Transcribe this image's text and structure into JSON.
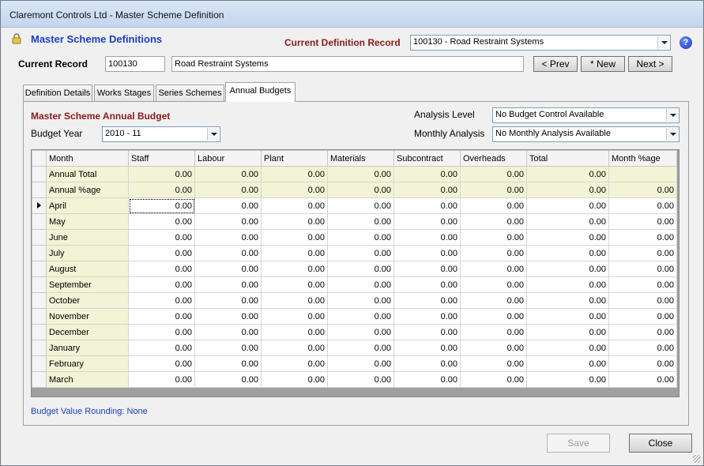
{
  "window": {
    "title": "Claremont Controls Ltd - Master Scheme Definition"
  },
  "header": {
    "title": "Master Scheme Definitions",
    "current_definition_label": "Current Definition Record",
    "current_definition_value": "100130 - Road Restraint Systems",
    "help_glyph": "?",
    "lock_icon": "padlock-icon"
  },
  "record": {
    "label": "Current Record",
    "code": "100130",
    "name": "Road Restraint Systems",
    "prev_label": "< Prev",
    "new_label": "* New",
    "next_label": "Next >"
  },
  "tabs": [
    "Definition Details",
    "Works Stages",
    "Series Schemes",
    "Annual Budgets"
  ],
  "budget": {
    "section_title": "Master Scheme Annual Budget",
    "year_label": "Budget Year",
    "year_value": "2010 - 11",
    "analysis_level_label": "Analysis Level",
    "analysis_level_value": "No Budget Control Available",
    "monthly_analysis_label": "Monthly Analysis",
    "monthly_analysis_value": "No Monthly Analysis Available",
    "rounding_text": "Budget Value Rounding: None"
  },
  "grid": {
    "columns": [
      "Month",
      "Staff",
      "Labour",
      "Plant",
      "Materials",
      "Subcontract",
      "Overheads",
      "Total",
      "Month %age"
    ],
    "summary_rows": [
      {
        "label": "Annual Total",
        "values": [
          "0.00",
          "0.00",
          "0.00",
          "0.00",
          "0.00",
          "0.00",
          "0.00",
          ""
        ]
      },
      {
        "label": "Annual %age",
        "values": [
          "0.00",
          "0.00",
          "0.00",
          "0.00",
          "0.00",
          "0.00",
          "0.00",
          "0.00"
        ]
      }
    ],
    "month_rows": [
      {
        "label": "April",
        "values": [
          "0.00",
          "0.00",
          "0.00",
          "0.00",
          "0.00",
          "0.00",
          "0.00",
          "0.00"
        ]
      },
      {
        "label": "May",
        "values": [
          "0.00",
          "0.00",
          "0.00",
          "0.00",
          "0.00",
          "0.00",
          "0.00",
          "0.00"
        ]
      },
      {
        "label": "June",
        "values": [
          "0.00",
          "0.00",
          "0.00",
          "0.00",
          "0.00",
          "0.00",
          "0.00",
          "0.00"
        ]
      },
      {
        "label": "July",
        "values": [
          "0.00",
          "0.00",
          "0.00",
          "0.00",
          "0.00",
          "0.00",
          "0.00",
          "0.00"
        ]
      },
      {
        "label": "August",
        "values": [
          "0.00",
          "0.00",
          "0.00",
          "0.00",
          "0.00",
          "0.00",
          "0.00",
          "0.00"
        ]
      },
      {
        "label": "September",
        "values": [
          "0.00",
          "0.00",
          "0.00",
          "0.00",
          "0.00",
          "0.00",
          "0.00",
          "0.00"
        ]
      },
      {
        "label": "October",
        "values": [
          "0.00",
          "0.00",
          "0.00",
          "0.00",
          "0.00",
          "0.00",
          "0.00",
          "0.00"
        ]
      },
      {
        "label": "November",
        "values": [
          "0.00",
          "0.00",
          "0.00",
          "0.00",
          "0.00",
          "0.00",
          "0.00",
          "0.00"
        ]
      },
      {
        "label": "December",
        "values": [
          "0.00",
          "0.00",
          "0.00",
          "0.00",
          "0.00",
          "0.00",
          "0.00",
          "0.00"
        ]
      },
      {
        "label": "January",
        "values": [
          "0.00",
          "0.00",
          "0.00",
          "0.00",
          "0.00",
          "0.00",
          "0.00",
          "0.00"
        ]
      },
      {
        "label": "February",
        "values": [
          "0.00",
          "0.00",
          "0.00",
          "0.00",
          "0.00",
          "0.00",
          "0.00",
          "0.00"
        ]
      },
      {
        "label": "March",
        "values": [
          "0.00",
          "0.00",
          "0.00",
          "0.00",
          "0.00",
          "0.00",
          "0.00",
          "0.00"
        ]
      }
    ]
  },
  "footer": {
    "save_label": "Save",
    "close_label": "Close"
  },
  "colors": {
    "accent_blue": "#1a3fc2",
    "accent_red": "#8b1a1a",
    "month_bg": "#f3f3d6"
  }
}
